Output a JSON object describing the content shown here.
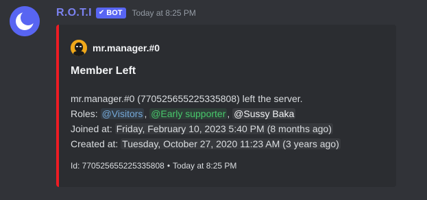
{
  "message": {
    "avatar_icon": "crescent-moon-icon",
    "username": "R.O.T.I",
    "bot_tag": "BOT",
    "timestamp": "Today at 8:25 PM",
    "colors": {
      "username": "#7b82f0",
      "bot_tag": "#5865f2",
      "embed_bar": "#ed1c24"
    }
  },
  "embed": {
    "author_icon": "user-avatar-icon",
    "author_name": "mr.manager.#0",
    "title": "Member Left",
    "left_line": "mr.manager.#0 (770525655225335808) left the server.",
    "roles_label": "Roles:",
    "roles": [
      "@Visitors",
      "@Early supporter",
      "@Sussy Baka"
    ],
    "role_separator": ",",
    "joined_label": "Joined at:",
    "joined_date": "Friday, February 10, 2023 5:40 PM",
    "joined_relative": "8 months ago",
    "created_label": "Created at:",
    "created_date": "Tuesday, October 27, 2020 11:23 AM",
    "created_relative": "3 years ago",
    "footer_id": "Id: 770525655225335808",
    "footer_separator": "•",
    "footer_time": "Today at 8:25 PM"
  }
}
